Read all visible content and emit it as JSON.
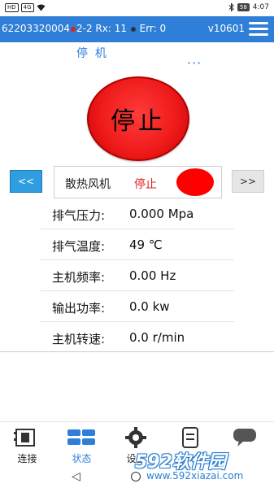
{
  "status_bar": {
    "left_badges": [
      "HD",
      "4G"
    ],
    "battery": "58",
    "time": "4:07"
  },
  "app_bar": {
    "device_id": "62203320004",
    "link_status": "2-2 Rx: 11",
    "errors": "Err: 0",
    "version": "v10601",
    "colors": {
      "bar": "#2f7fd8",
      "link_dot": "#e02020",
      "err_dot": "#333333"
    }
  },
  "machine_state": {
    "label": "停  机",
    "more": "···"
  },
  "main_button": {
    "label": "停止",
    "color": "#f01c1c"
  },
  "device_selector": {
    "prev_label": "<<",
    "next_label": ">>",
    "name": "散热风机",
    "state": "停止",
    "indicator_color": "#ff0000"
  },
  "readings": [
    {
      "label": "排气压力:",
      "value": "0.000 Mpa"
    },
    {
      "label": "排气温度:",
      "value": "49 ℃"
    },
    {
      "label": "主机频率:",
      "value": "0.00 Hz"
    },
    {
      "label": "输出功率:",
      "value": "0.0 kw"
    },
    {
      "label": "主机转速:",
      "value": "0.0 r/min"
    }
  ],
  "tabs": [
    {
      "label": "连接",
      "icon": "connection-icon",
      "active": false
    },
    {
      "label": "状态",
      "icon": "status-icon",
      "active": true
    },
    {
      "label": "设置",
      "icon": "gear-icon",
      "active": false
    },
    {
      "label": "",
      "icon": "device-icon",
      "active": false
    },
    {
      "label": "",
      "icon": "chat-icon",
      "active": false
    }
  ],
  "watermark": {
    "title": "592软件园",
    "url": "www.592xiazai.com"
  }
}
